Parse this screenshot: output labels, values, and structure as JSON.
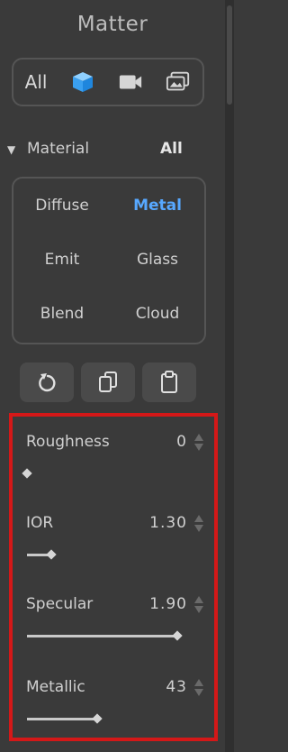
{
  "panel": {
    "title": "Matter"
  },
  "filter": {
    "all_label": "All",
    "icons": [
      "cube-icon",
      "video-camera-icon",
      "image-icon"
    ],
    "active": "cube-icon"
  },
  "material_section": {
    "arrow": "▼",
    "label": "Material",
    "all_label": "All",
    "items": [
      {
        "label": "Diffuse"
      },
      {
        "label": "Metal",
        "selected": true
      },
      {
        "label": "Emit"
      },
      {
        "label": "Glass"
      },
      {
        "label": "Blend"
      },
      {
        "label": "Cloud"
      }
    ]
  },
  "toolbar": {
    "buttons": [
      "reset-icon",
      "copy-icon",
      "paste-icon"
    ]
  },
  "params": [
    {
      "label": "Roughness",
      "value": "0",
      "fraction": 0.0
    },
    {
      "label": "IOR",
      "value": "1.30",
      "fraction": 0.16
    },
    {
      "label": "Specular",
      "value": "1.90",
      "fraction": 0.98
    },
    {
      "label": "Metallic",
      "value": "43",
      "fraction": 0.46
    }
  ],
  "colors": {
    "accent": "#57a8ff",
    "highlight": "#d41818",
    "background": "#3a3a3a"
  }
}
